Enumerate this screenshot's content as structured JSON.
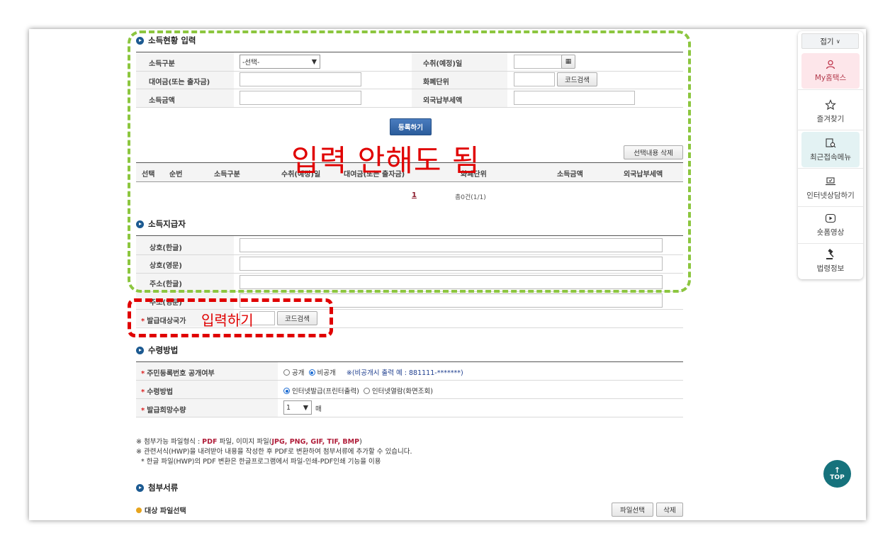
{
  "income_input": {
    "title": "소득현황 입력",
    "labels": {
      "income_type": "소득구분",
      "received_date": "수취(예정)일",
      "loan_amount": "대여금(또는 출자금)",
      "currency_unit": "화폐단위",
      "income_amount": "소득금액",
      "foreign_tax": "외국납부세액"
    },
    "income_type_selected": "-선택-",
    "code_search": "코드검색",
    "register": "등록하기",
    "delete_selected": "선택내용 삭제",
    "table_headers": [
      "선택",
      "순번",
      "소득구분",
      "수취(예정)일",
      "대여금(또는 출자금)",
      "화폐단위",
      "소득금액",
      "외국납부세액"
    ],
    "page_current": "1",
    "total": "총0건(1/1)"
  },
  "payer": {
    "title": "소득지급자",
    "labels": {
      "name_ko": "상호(한글)",
      "name_en": "상호(영문)",
      "addr_ko": "주소(한글)",
      "addr_en": "주소(영문)",
      "issue_country": "발급대상국가"
    },
    "code_search": "코드검색"
  },
  "receive": {
    "title": "수령방법",
    "rrn_label": "주민등록번호 공개여부",
    "rrn_options": [
      "공개",
      "비공개"
    ],
    "rrn_selected": "비공개",
    "rrn_note": "※(비공개시 출력 예 : 881111-*******)",
    "method_label": "수령방법",
    "method_options": [
      "인터넷발급(프린터출력)",
      "인터넷열람(화면조회)"
    ],
    "method_selected": "인터넷발급(프린터출력)",
    "qty_label": "발급희망수량",
    "qty_value": "1",
    "qty_unit": "매"
  },
  "notes": {
    "line1_prefix": "※ 첨부가능 파일형식 : ",
    "line1_pdf": "PDF",
    "line1_mid": " 파일, 이미지 파일(",
    "line1_img": "JPG, PNG, GIF, TIF, BMP",
    "line1_suffix": ")",
    "line2": "※ 관련서식(HWP)을 내려받아 내용을 작성한 후 PDF로 변환하여 첨부서류에 추가할 수 있습니다.",
    "line3": "* 한글 파일(HWP)의 PDF 변환은 한글프로그램에서 파일-인쇄-PDF인쇄 기능을 이용"
  },
  "attach": {
    "title": "첨부서류",
    "target_label": "대상 파일선택",
    "select_file": "파일선택",
    "delete": "삭제"
  },
  "sidebar": {
    "collapse": "접기",
    "items": [
      "My홈택스",
      "즐겨찾기",
      "최근접속메뉴",
      "인터넷상담하기",
      "숏폼영상",
      "법령정보"
    ]
  },
  "top_button": "TOP",
  "annotations": {
    "no_input": "입력 안해도 됨",
    "do_input": "입력하기"
  },
  "colors": {
    "green_dash": "#8cc63f",
    "red_dash": "#e00000",
    "primary_button": "#2b5c9b",
    "top_button": "#16727c"
  }
}
